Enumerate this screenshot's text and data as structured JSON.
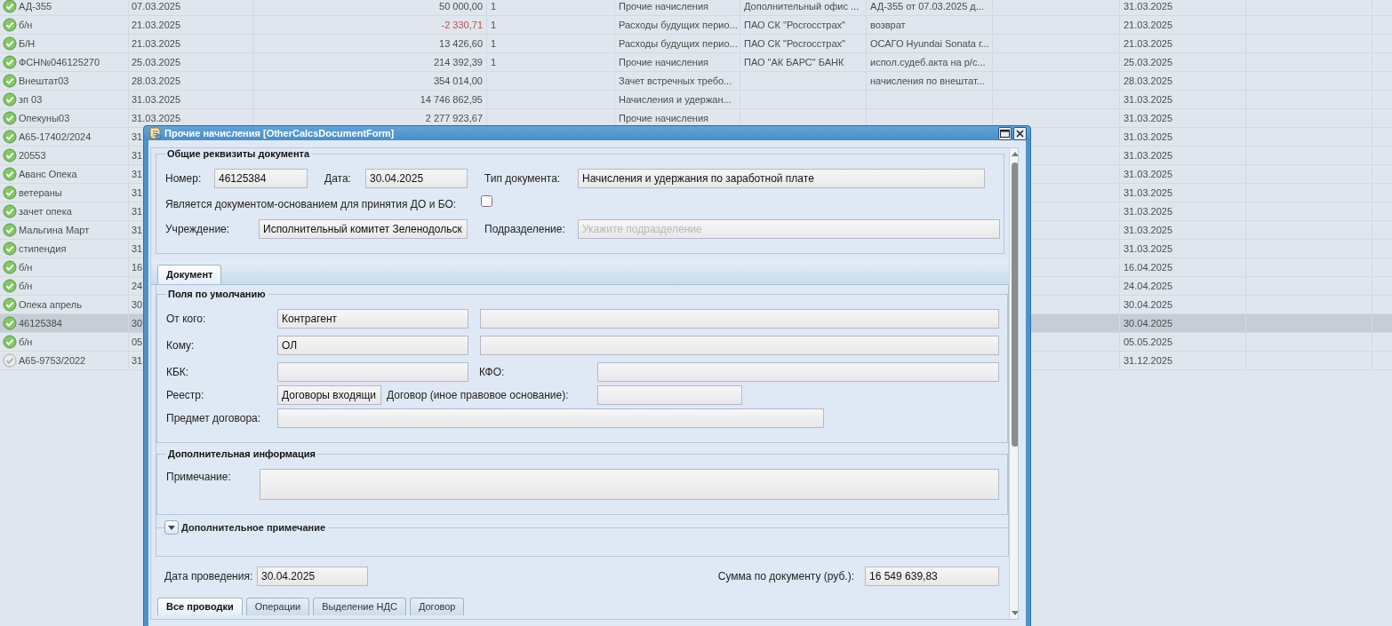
{
  "grid": {
    "rows": [
      {
        "done": true,
        "selected": false,
        "negative": false,
        "number": "АД-355",
        "date": "07.03.2025",
        "amount": "50 000,00",
        "count": "1",
        "type": "Прочие начисления",
        "org": "Дополнительный офис ...",
        "desc": "АД-355 от 07.03.2025 д...",
        "date2": "31.03.2025"
      },
      {
        "done": true,
        "selected": false,
        "negative": true,
        "number": "б/н",
        "date": "21.03.2025",
        "amount": "-2 330,71",
        "count": "1",
        "type": "Расходы будущих перио...",
        "org": "ПАО СК \"Росгосстрах\"",
        "desc": "возврат",
        "date2": "21.03.2025"
      },
      {
        "done": true,
        "selected": false,
        "negative": false,
        "number": "Б/Н",
        "date": "21.03.2025",
        "amount": "13 426,60",
        "count": "1",
        "type": "Расходы будущих перио...",
        "org": "ПАО СК \"Росгосстрах\"",
        "desc": "ОСАГО Hyundai Sonata г...",
        "date2": "21.03.2025"
      },
      {
        "done": true,
        "selected": false,
        "negative": false,
        "number": "ФСН№046125270",
        "date": "25.03.2025",
        "amount": "214 392,39",
        "count": "1",
        "type": "Прочие начисления",
        "org": "ПАО \"АК БАРС\" БАНК",
        "desc": "испол.судеб.акта на р/с...",
        "date2": "25.03.2025"
      },
      {
        "done": true,
        "selected": false,
        "negative": false,
        "number": "Внештат03",
        "date": "28.03.2025",
        "amount": "354 014,00",
        "type": "Зачет встречных требо...",
        "desc": "начисления по внештат...",
        "date2": "28.03.2025"
      },
      {
        "done": true,
        "selected": false,
        "negative": false,
        "number": "зп 03",
        "date": "31.03.2025",
        "amount": "14 746 862,95",
        "type": "Начисления и удержан...",
        "date2": "31.03.2025"
      },
      {
        "done": true,
        "selected": false,
        "negative": false,
        "number": "Опекуны03",
        "date": "31.03.2025",
        "amount": "2 277 923,67",
        "type": "Прочие начисления",
        "date2": "31.03.2025"
      },
      {
        "done": true,
        "selected": false,
        "number": "А65-17402/2024",
        "date": "31",
        "date2": "31.03.2025"
      },
      {
        "done": true,
        "selected": false,
        "number": "20553",
        "date": "31",
        "date2": "31.03.2025"
      },
      {
        "done": true,
        "selected": false,
        "number": "Аванс Опека",
        "date": "31",
        "date2": "31.03.2025"
      },
      {
        "done": true,
        "selected": false,
        "number": "ветераны",
        "date": "31",
        "date2": "31.03.2025"
      },
      {
        "done": true,
        "selected": false,
        "number": "зачет опека",
        "date": "31",
        "date2": "31.03.2025"
      },
      {
        "done": true,
        "selected": false,
        "number": "Мальгина Март",
        "date": "31",
        "date2": "31.03.2025"
      },
      {
        "done": true,
        "selected": false,
        "number": "стипендия",
        "date": "31",
        "date2": "31.03.2025"
      },
      {
        "done": true,
        "selected": false,
        "number": "б/н",
        "date": "16",
        "date2": "16.04.2025"
      },
      {
        "done": true,
        "selected": false,
        "number": "б/н",
        "date": "24",
        "date2": "24.04.2025"
      },
      {
        "done": true,
        "selected": false,
        "number": "Опека апрель",
        "date": "30",
        "date2": "30.04.2025"
      },
      {
        "done": true,
        "selected": true,
        "number": "46125384",
        "date": "30",
        "date2": "30.04.2025"
      },
      {
        "done": true,
        "selected": false,
        "number": "б/н",
        "date": "05",
        "date2": "05.05.2025"
      },
      {
        "done": false,
        "selected": false,
        "number": "А65-9753/2022",
        "date": "31",
        "date2": "31.12.2025"
      }
    ]
  },
  "dialog": {
    "title": "Прочие начисления [OtherCalcsDocumentForm]",
    "general": {
      "legend": "Общие реквизиты документа",
      "number": {
        "label": "Номер:",
        "value": "46125384"
      },
      "date": {
        "label": "Дата:",
        "value": "30.04.2025"
      },
      "doc_type": {
        "label": "Тип документа:",
        "value": "Начисления и удержания по заработной плате"
      },
      "basis": {
        "label": "Является документом-основанием для принятия ДО и БО:",
        "checked": false
      },
      "institution": {
        "label": "Учреждение:",
        "value": "Исполнительный комитет Зеленодольск"
      },
      "division": {
        "label": "Подразделение:",
        "placeholder": "Укажите подразделение"
      }
    },
    "tabs": [
      {
        "label": "Документ",
        "selected": true
      }
    ],
    "defaults": {
      "legend": "Поля по умолчанию",
      "from": {
        "label": "От кого:",
        "value": "Контрагент"
      },
      "to": {
        "label": "Кому:",
        "value": "ОЛ"
      },
      "kbk": {
        "label": "КБК:"
      },
      "kfo": {
        "label": "КФО:"
      },
      "registry": {
        "label": "Реестр:",
        "value": "Договоры входящи"
      },
      "contract": {
        "label": "Договор (иное правовое основание):"
      },
      "subject": {
        "label": "Предмет договора:"
      }
    },
    "extra": {
      "legend": "Дополнительная информация",
      "note": {
        "label": "Примечание:"
      }
    },
    "extra_note": {
      "legend": "Дополнительное примечание",
      "expanded": false
    },
    "posting_date": {
      "label": "Дата проведения:",
      "value": "30.04.2025"
    },
    "total": {
      "label": "Сумма по документу (руб.):",
      "value": "16 549 639,83"
    },
    "bottom_tabs": [
      {
        "label": "Все проводки",
        "selected": true
      },
      {
        "label": "Операции",
        "selected": false
      },
      {
        "label": "Выделение НДС",
        "selected": false
      },
      {
        "label": "Договор",
        "selected": false
      }
    ]
  }
}
